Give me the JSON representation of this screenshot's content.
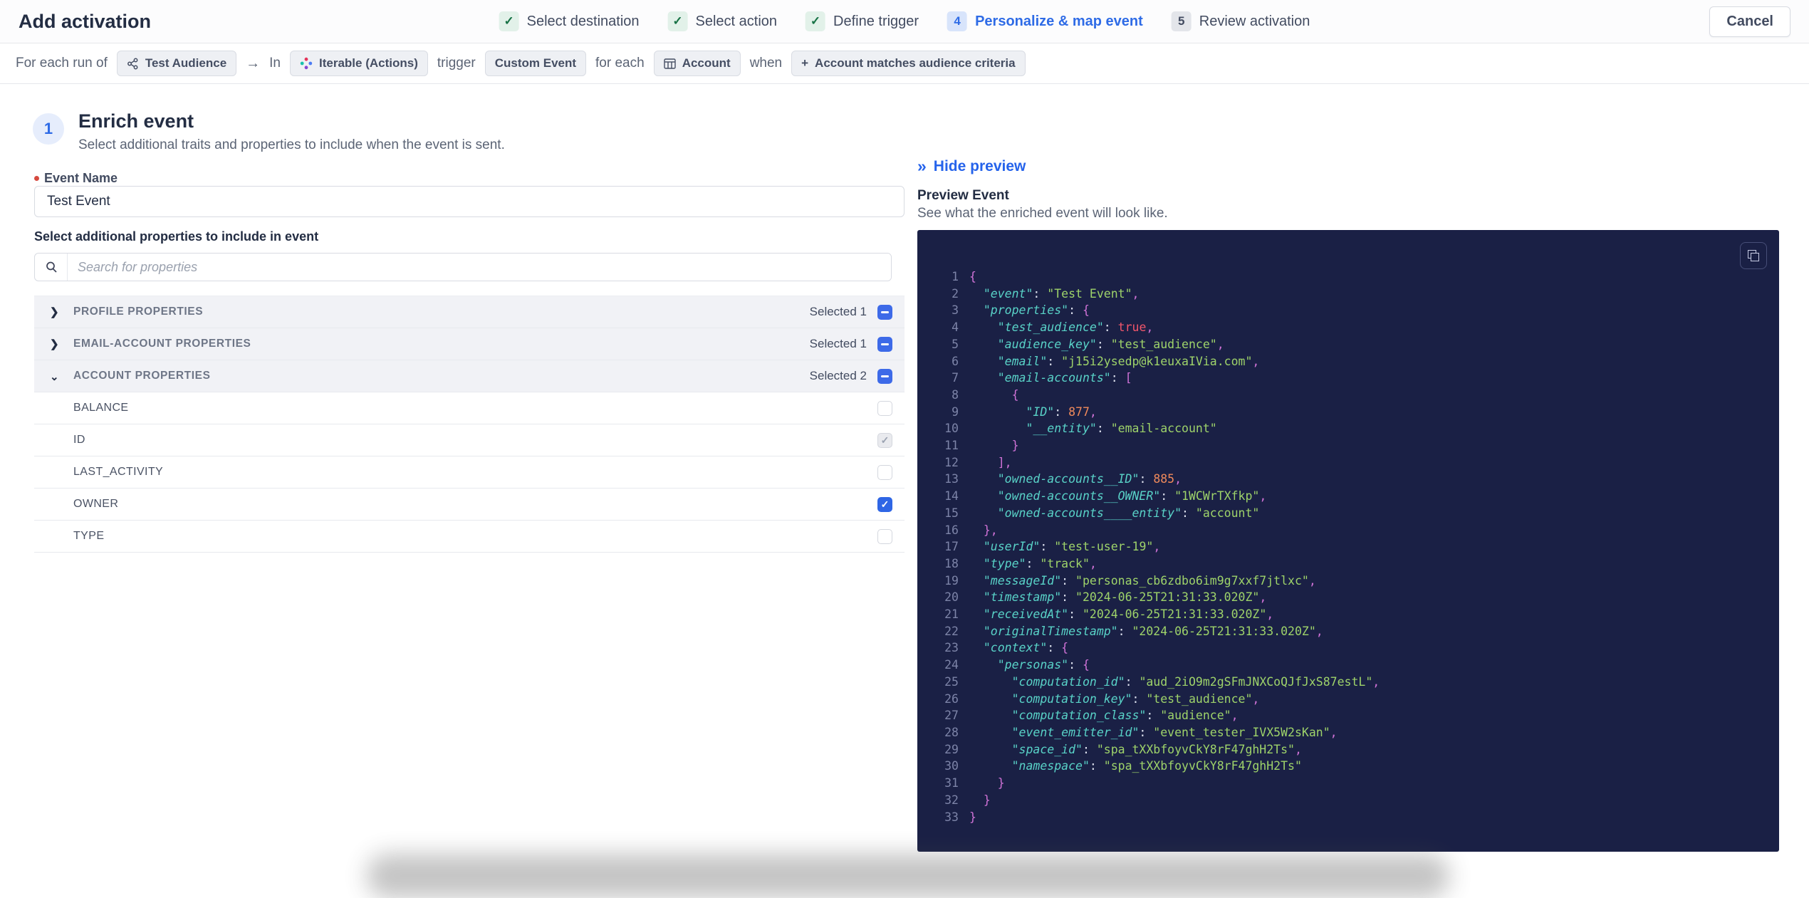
{
  "header": {
    "title": "Add activation",
    "cancel_label": "Cancel",
    "steps": [
      {
        "badge": "✓",
        "label": "Select destination",
        "state": "done"
      },
      {
        "badge": "✓",
        "label": "Select action",
        "state": "done"
      },
      {
        "badge": "✓",
        "label": "Define trigger",
        "state": "done"
      },
      {
        "badge": "4",
        "label": "Personalize & map event",
        "state": "current"
      },
      {
        "badge": "5",
        "label": "Review activation",
        "state": "upcoming"
      }
    ]
  },
  "trigger_bar": {
    "prefix": "For each run of",
    "audience_chip": "Test Audience",
    "arrow": "→",
    "in_word": "In",
    "destination_chip": "Iterable (Actions)",
    "trigger_word": "trigger",
    "event_chip": "Custom Event",
    "for_each_word": "for each",
    "entity_chip": "Account",
    "when_word": "when",
    "criteria_plus": "+",
    "criteria_chip": "Account matches audience criteria"
  },
  "enrich": {
    "step_number": "1",
    "title": "Enrich event",
    "subtitle": "Select additional traits and properties to include when the event is sent.",
    "event_name_label": "Event Name",
    "event_name_value": "Test Event",
    "properties_heading": "Select additional properties to include in event",
    "search_placeholder": "Search for properties",
    "groups": [
      {
        "label": "PROFILE PROPERTIES",
        "selected": "Selected 1",
        "expanded": false,
        "checkbox": "indeterminate"
      },
      {
        "label": "EMAIL-ACCOUNT PROPERTIES",
        "selected": "Selected 1",
        "expanded": false,
        "checkbox": "indeterminate"
      },
      {
        "label": "ACCOUNT PROPERTIES",
        "selected": "Selected 2",
        "expanded": true,
        "checkbox": "indeterminate"
      }
    ],
    "account_properties": [
      {
        "label": "BALANCE",
        "checkbox": "empty"
      },
      {
        "label": "ID",
        "checkbox": "checked-disabled"
      },
      {
        "label": "LAST_ACTIVITY",
        "checkbox": "empty"
      },
      {
        "label": "OWNER",
        "checkbox": "checked"
      },
      {
        "label": "TYPE",
        "checkbox": "empty"
      }
    ]
  },
  "preview": {
    "hide_label": "Hide preview",
    "hide_icon": "»",
    "title": "Preview Event",
    "subtitle": "See what the enriched event will look like.",
    "code_lines": [
      {
        "n": "1",
        "t": [
          [
            "p",
            "{"
          ]
        ]
      },
      {
        "n": "2",
        "t": [
          [
            "c",
            "  "
          ],
          [
            "k",
            "\"event\""
          ],
          [
            "c",
            ": "
          ],
          [
            "s",
            "\"Test Event\""
          ],
          [
            "p",
            ","
          ]
        ]
      },
      {
        "n": "3",
        "t": [
          [
            "c",
            "  "
          ],
          [
            "k",
            "\"properties\""
          ],
          [
            "c",
            ": "
          ],
          [
            "p",
            "{"
          ]
        ]
      },
      {
        "n": "4",
        "t": [
          [
            "c",
            "    "
          ],
          [
            "k",
            "\"test_audience\""
          ],
          [
            "c",
            ": "
          ],
          [
            "b",
            "true"
          ],
          [
            "p",
            ","
          ]
        ]
      },
      {
        "n": "5",
        "t": [
          [
            "c",
            "    "
          ],
          [
            "k",
            "\"audience_key\""
          ],
          [
            "c",
            ": "
          ],
          [
            "s",
            "\"test_audience\""
          ],
          [
            "p",
            ","
          ]
        ]
      },
      {
        "n": "6",
        "t": [
          [
            "c",
            "    "
          ],
          [
            "k",
            "\"email\""
          ],
          [
            "c",
            ": "
          ],
          [
            "s",
            "\"j15i2ysedp@k1euxaIVia.com\""
          ],
          [
            "p",
            ","
          ]
        ]
      },
      {
        "n": "7",
        "t": [
          [
            "c",
            "    "
          ],
          [
            "k",
            "\"email-accounts\""
          ],
          [
            "c",
            ": "
          ],
          [
            "p",
            "["
          ]
        ]
      },
      {
        "n": "8",
        "t": [
          [
            "c",
            "      "
          ],
          [
            "p",
            "{"
          ]
        ]
      },
      {
        "n": "9",
        "t": [
          [
            "c",
            "        "
          ],
          [
            "k",
            "\"ID\""
          ],
          [
            "c",
            ": "
          ],
          [
            "n",
            "877"
          ],
          [
            "p",
            ","
          ]
        ]
      },
      {
        "n": "10",
        "t": [
          [
            "c",
            "        "
          ],
          [
            "k",
            "\"__entity\""
          ],
          [
            "c",
            ": "
          ],
          [
            "s",
            "\"email-account\""
          ]
        ]
      },
      {
        "n": "11",
        "t": [
          [
            "c",
            "      "
          ],
          [
            "p",
            "}"
          ]
        ]
      },
      {
        "n": "12",
        "t": [
          [
            "c",
            "    "
          ],
          [
            "p",
            "],"
          ]
        ]
      },
      {
        "n": "13",
        "t": [
          [
            "c",
            "    "
          ],
          [
            "k",
            "\"owned-accounts__ID\""
          ],
          [
            "c",
            ": "
          ],
          [
            "n",
            "885"
          ],
          [
            "p",
            ","
          ]
        ]
      },
      {
        "n": "14",
        "t": [
          [
            "c",
            "    "
          ],
          [
            "k",
            "\"owned-accounts__OWNER\""
          ],
          [
            "c",
            ": "
          ],
          [
            "s",
            "\"1WCWrTXfkp\""
          ],
          [
            "p",
            ","
          ]
        ]
      },
      {
        "n": "15",
        "t": [
          [
            "c",
            "    "
          ],
          [
            "k",
            "\"owned-accounts____entity\""
          ],
          [
            "c",
            ": "
          ],
          [
            "s",
            "\"account\""
          ]
        ]
      },
      {
        "n": "16",
        "t": [
          [
            "c",
            "  "
          ],
          [
            "p",
            "},"
          ]
        ]
      },
      {
        "n": "17",
        "t": [
          [
            "c",
            "  "
          ],
          [
            "k",
            "\"userId\""
          ],
          [
            "c",
            ": "
          ],
          [
            "s",
            "\"test-user-19\""
          ],
          [
            "p",
            ","
          ]
        ]
      },
      {
        "n": "18",
        "t": [
          [
            "c",
            "  "
          ],
          [
            "k",
            "\"type\""
          ],
          [
            "c",
            ": "
          ],
          [
            "s",
            "\"track\""
          ],
          [
            "p",
            ","
          ]
        ]
      },
      {
        "n": "19",
        "t": [
          [
            "c",
            "  "
          ],
          [
            "k",
            "\"messageId\""
          ],
          [
            "c",
            ": "
          ],
          [
            "s",
            "\"personas_cb6zdbo6im9g7xxf7jtlxc\""
          ],
          [
            "p",
            ","
          ]
        ]
      },
      {
        "n": "20",
        "t": [
          [
            "c",
            "  "
          ],
          [
            "k",
            "\"timestamp\""
          ],
          [
            "c",
            ": "
          ],
          [
            "s",
            "\"2024-06-25T21:31:33.020Z\""
          ],
          [
            "p",
            ","
          ]
        ]
      },
      {
        "n": "21",
        "t": [
          [
            "c",
            "  "
          ],
          [
            "k",
            "\"receivedAt\""
          ],
          [
            "c",
            ": "
          ],
          [
            "s",
            "\"2024-06-25T21:31:33.020Z\""
          ],
          [
            "p",
            ","
          ]
        ]
      },
      {
        "n": "22",
        "t": [
          [
            "c",
            "  "
          ],
          [
            "k",
            "\"originalTimestamp\""
          ],
          [
            "c",
            ": "
          ],
          [
            "s",
            "\"2024-06-25T21:31:33.020Z\""
          ],
          [
            "p",
            ","
          ]
        ]
      },
      {
        "n": "23",
        "t": [
          [
            "c",
            "  "
          ],
          [
            "k",
            "\"context\""
          ],
          [
            "c",
            ": "
          ],
          [
            "p",
            "{"
          ]
        ]
      },
      {
        "n": "24",
        "t": [
          [
            "c",
            "    "
          ],
          [
            "k",
            "\"personas\""
          ],
          [
            "c",
            ": "
          ],
          [
            "p",
            "{"
          ]
        ]
      },
      {
        "n": "25",
        "t": [
          [
            "c",
            "      "
          ],
          [
            "k",
            "\"computation_id\""
          ],
          [
            "c",
            ": "
          ],
          [
            "s",
            "\"aud_2iO9m2gSFmJNXCoQJfJxS87estL\""
          ],
          [
            "p",
            ","
          ]
        ]
      },
      {
        "n": "26",
        "t": [
          [
            "c",
            "      "
          ],
          [
            "k",
            "\"computation_key\""
          ],
          [
            "c",
            ": "
          ],
          [
            "s",
            "\"test_audience\""
          ],
          [
            "p",
            ","
          ]
        ]
      },
      {
        "n": "27",
        "t": [
          [
            "c",
            "      "
          ],
          [
            "k",
            "\"computation_class\""
          ],
          [
            "c",
            ": "
          ],
          [
            "s",
            "\"audience\""
          ],
          [
            "p",
            ","
          ]
        ]
      },
      {
        "n": "28",
        "t": [
          [
            "c",
            "      "
          ],
          [
            "k",
            "\"event_emitter_id\""
          ],
          [
            "c",
            ": "
          ],
          [
            "s",
            "\"event_tester_IVX5W2sKan\""
          ],
          [
            "p",
            ","
          ]
        ]
      },
      {
        "n": "29",
        "t": [
          [
            "c",
            "      "
          ],
          [
            "k",
            "\"space_id\""
          ],
          [
            "c",
            ": "
          ],
          [
            "s",
            "\"spa_tXXbfoyvCkY8rF47ghH2Ts\""
          ],
          [
            "p",
            ","
          ]
        ]
      },
      {
        "n": "30",
        "t": [
          [
            "c",
            "      "
          ],
          [
            "k",
            "\"namespace\""
          ],
          [
            "c",
            ": "
          ],
          [
            "s",
            "\"spa_tXXbfoyvCkY8rF47ghH2Ts\""
          ]
        ]
      },
      {
        "n": "31",
        "t": [
          [
            "c",
            "    "
          ],
          [
            "p",
            "}"
          ]
        ]
      },
      {
        "n": "32",
        "t": [
          [
            "c",
            "  "
          ],
          [
            "p",
            "}"
          ]
        ]
      },
      {
        "n": "33",
        "t": [
          [
            "p",
            "}"
          ]
        ]
      }
    ]
  },
  "colors": {
    "accent_blue": "#2e6be6",
    "checkbox_blue": "#3d6ae8",
    "done_green": "#177245",
    "done_green_bg": "#e2f1e9",
    "code_background": "#1a2045",
    "code_key": "#59d3c8",
    "code_string": "#9ed36a",
    "code_number": "#f08a5b",
    "code_boolean": "#f2566b",
    "code_punctuation": "#d173d8"
  }
}
